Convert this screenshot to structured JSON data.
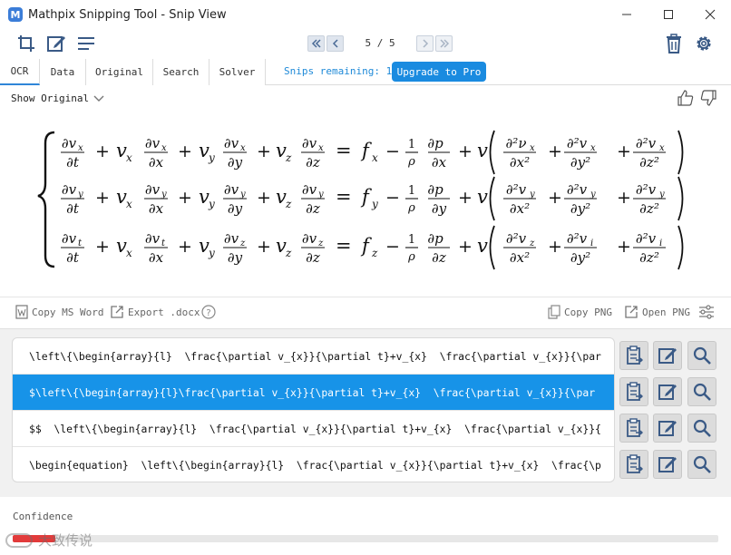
{
  "window": {
    "app_badge": "M",
    "title": "Mathpix Snipping Tool - Snip View"
  },
  "toolbar": {
    "page_current": "5",
    "page_separator": "/",
    "page_total": "5"
  },
  "tabs": [
    {
      "label": "OCR",
      "active": true
    },
    {
      "label": "Data",
      "active": false
    },
    {
      "label": "Original",
      "active": false
    },
    {
      "label": "Search",
      "active": false
    },
    {
      "label": "Solver",
      "active": false
    }
  ],
  "snips": {
    "label": "Snips remaining:",
    "count": "14",
    "upgrade_label": "Upgrade to Pro"
  },
  "preview": {
    "show_original_label": "Show Original"
  },
  "equation": {
    "rows": [
      {
        "var": "x",
        "rhs_f": "f",
        "rhs_sub": "x",
        "d_p": "x",
        "vis_num": "∂²ν",
        "vis_num_sub": "x",
        "vis_den": "∂x²",
        "vis2_num": "∂²v",
        "vis2_num_sub": "x",
        "vis2_den": "∂y²",
        "vis3_num": "∂²v",
        "vis3_num_sub": "x",
        "vis3_den": "∂z²"
      },
      {
        "var": "y",
        "rhs_f": "f",
        "rhs_sub": "y",
        "d_p": "y",
        "vis_num": "∂²v",
        "vis_num_sub": "y",
        "vis_den": "∂x²",
        "vis2_num": "∂²v",
        "vis2_num_sub": "y",
        "vis2_den": "∂y²",
        "vis3_num": "∂²v",
        "vis3_num_sub": "y",
        "vis3_den": "∂z²"
      },
      {
        "var": "t",
        "rhs_f": "f",
        "rhs_sub": "z",
        "d_p": "z",
        "vis_num": "∂²v",
        "vis_num_sub": "z",
        "vis_den": "∂x²",
        "vis2_num": "∂²v",
        "vis2_num_sub": "i",
        "vis2_den": "∂y²",
        "vis3_num": "∂²v",
        "vis3_num_sub": "i",
        "vis3_den": "∂z²"
      }
    ],
    "row_terms": [
      {
        "t1": "x",
        "t2": "x",
        "t3": "x",
        "t4": "x"
      },
      {
        "t1": "y",
        "t2": "y",
        "t3": "y",
        "t4": "y"
      },
      {
        "t1": "t",
        "t2": "t",
        "t3": "z",
        "t4": "z"
      }
    ]
  },
  "actions": {
    "copy_ms_word": "Copy MS Word",
    "export_docx": "Export .docx",
    "help": "?",
    "copy_png": "Copy PNG",
    "open_png": "Open PNG"
  },
  "results": [
    {
      "text": "\\left\\{\\begin{array}{l}  \\frac{\\partial v_{x}}{\\partial t}+v_{x}  \\frac{\\partial v_{x}}{\\par",
      "selected": false
    },
    {
      "text": "$\\left\\{\\begin{array}{l}\\frac{\\partial v_{x}}{\\partial t}+v_{x}  \\frac{\\partial v_{x}}{\\par",
      "selected": true
    },
    {
      "text": "$$  \\left\\{\\begin{array}{l}  \\frac{\\partial v_{x}}{\\partial t}+v_{x}  \\frac{\\partial v_{x}}{",
      "selected": false
    },
    {
      "text": "\\begin{equation}  \\left\\{\\begin{array}{l}  \\frac{\\partial v_{x}}{\\partial t}+v_{x}  \\frac{\\p",
      "selected": false
    }
  ],
  "confidence": {
    "label": "Confidence",
    "level": 0.06
  },
  "watermark": {
    "text": "大致传说"
  },
  "colors": {
    "accent": "#1793e8",
    "upgrade": "#1a8be0",
    "confidence_low": "#e23b3b"
  }
}
